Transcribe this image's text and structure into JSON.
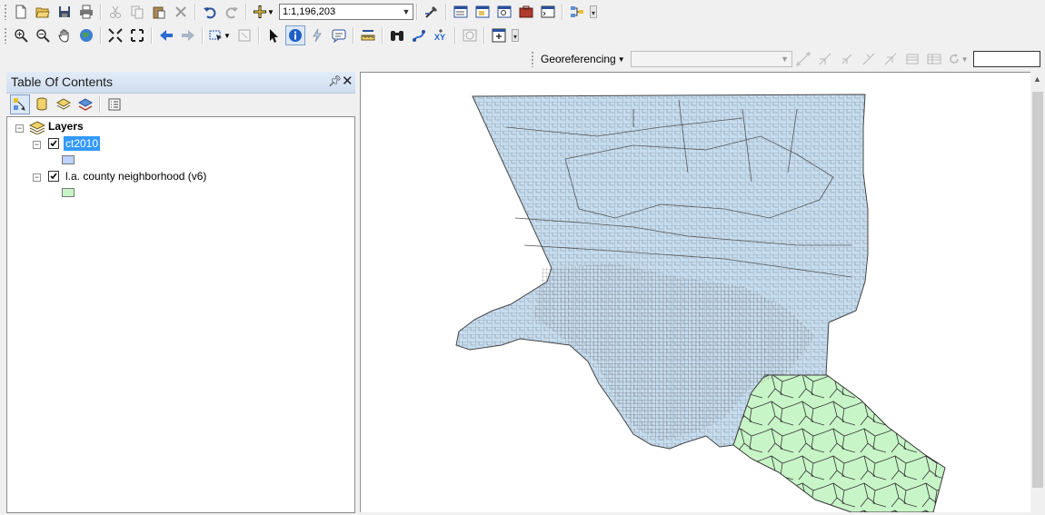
{
  "toolbar_standard": {
    "icons": [
      "new-icon",
      "open-icon",
      "save-icon",
      "print-icon",
      "cut-icon",
      "copy-icon",
      "paste-icon",
      "delete-icon",
      "undo-icon",
      "redo-icon",
      "add-data-icon"
    ],
    "scale_value": "1:1,196,203",
    "right_icons": [
      "editor-toolbar-icon",
      "toc-window-icon",
      "catalog-window-icon",
      "search-window-icon",
      "arctoolbox-icon",
      "python-window-icon",
      "model-builder-icon"
    ]
  },
  "toolbar_tools": {
    "icons": [
      "zoom-in-icon",
      "zoom-out-icon",
      "pan-icon",
      "full-extent-icon",
      "fixed-zoom-in-icon",
      "fixed-zoom-out-icon",
      "back-extent-icon",
      "forward-extent-icon",
      "select-features-icon",
      "clear-selection-icon",
      "select-elements-icon",
      "identify-icon",
      "hyperlink-icon",
      "html-popup-icon",
      "measure-icon",
      "find-icon",
      "find-route-icon",
      "go-to-xy-icon",
      "time-slider-icon",
      "create-viewer-icon"
    ]
  },
  "georef": {
    "label": "Georeferencing",
    "layer_value": "",
    "input_value": ""
  },
  "toc": {
    "title": "Table Of Contents",
    "root": "Layers",
    "layers": [
      {
        "name": "ct2010",
        "checked": true,
        "selected": true,
        "color": "#bed2ff"
      },
      {
        "name": "l.a. county neighborhood (v6)",
        "checked": true,
        "selected": false,
        "color": "#c8f5c8"
      }
    ]
  },
  "colors": {
    "selection": "#3399ff",
    "tract_fill": "#c6ddf0",
    "neighborhood_fill": "#c8f5c8",
    "outline": "#4a4a4a"
  }
}
